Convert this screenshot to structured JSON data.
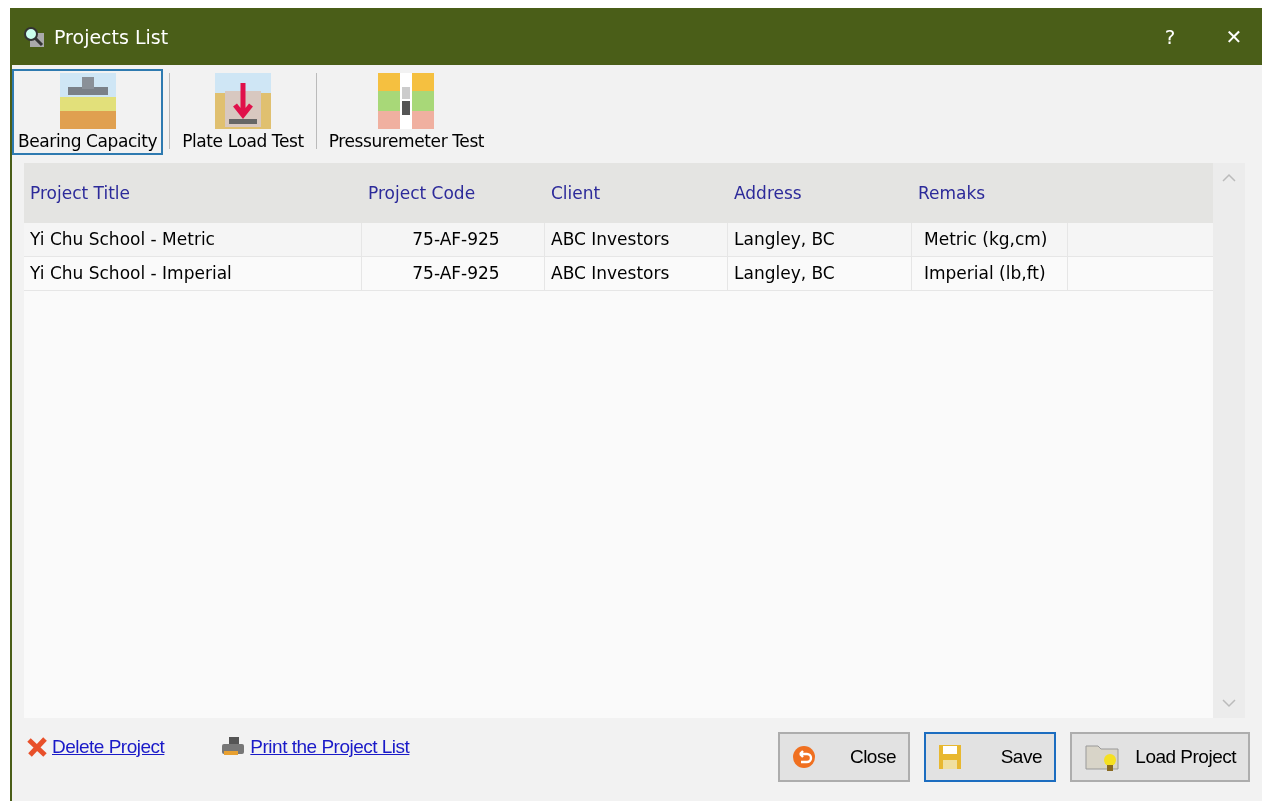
{
  "window": {
    "title": "Projects List",
    "help": "?",
    "close": "✕"
  },
  "tabs": [
    {
      "label": "Bearing Capacity",
      "kind": "footing",
      "selected": true
    },
    {
      "label": "Plate Load Test",
      "kind": "plate",
      "selected": false
    },
    {
      "label": "Pressuremeter Test",
      "kind": "probe",
      "selected": false
    }
  ],
  "table": {
    "columns": [
      "Project Title",
      "Project Code",
      "Client",
      "Address",
      "Remaks"
    ],
    "rows": [
      [
        "Yi Chu School - Metric",
        "75-AF-925",
        "ABC Investors",
        "Langley, BC",
        "Metric (kg,cm)"
      ],
      [
        "Yi Chu School - Imperial",
        "75-AF-925",
        "ABC Investors",
        "Langley, BC",
        "Imperial (lb,ft)"
      ]
    ]
  },
  "links": [
    {
      "label": "Delete Project",
      "kind": "delete"
    },
    {
      "label": "Print the Project List",
      "kind": "print"
    }
  ],
  "buttons": [
    {
      "label": "Close",
      "kind": "close",
      "selected": false
    },
    {
      "label": "Save",
      "kind": "save",
      "selected": true
    },
    {
      "label": "Load Project",
      "kind": "load",
      "selected": false
    }
  ]
}
